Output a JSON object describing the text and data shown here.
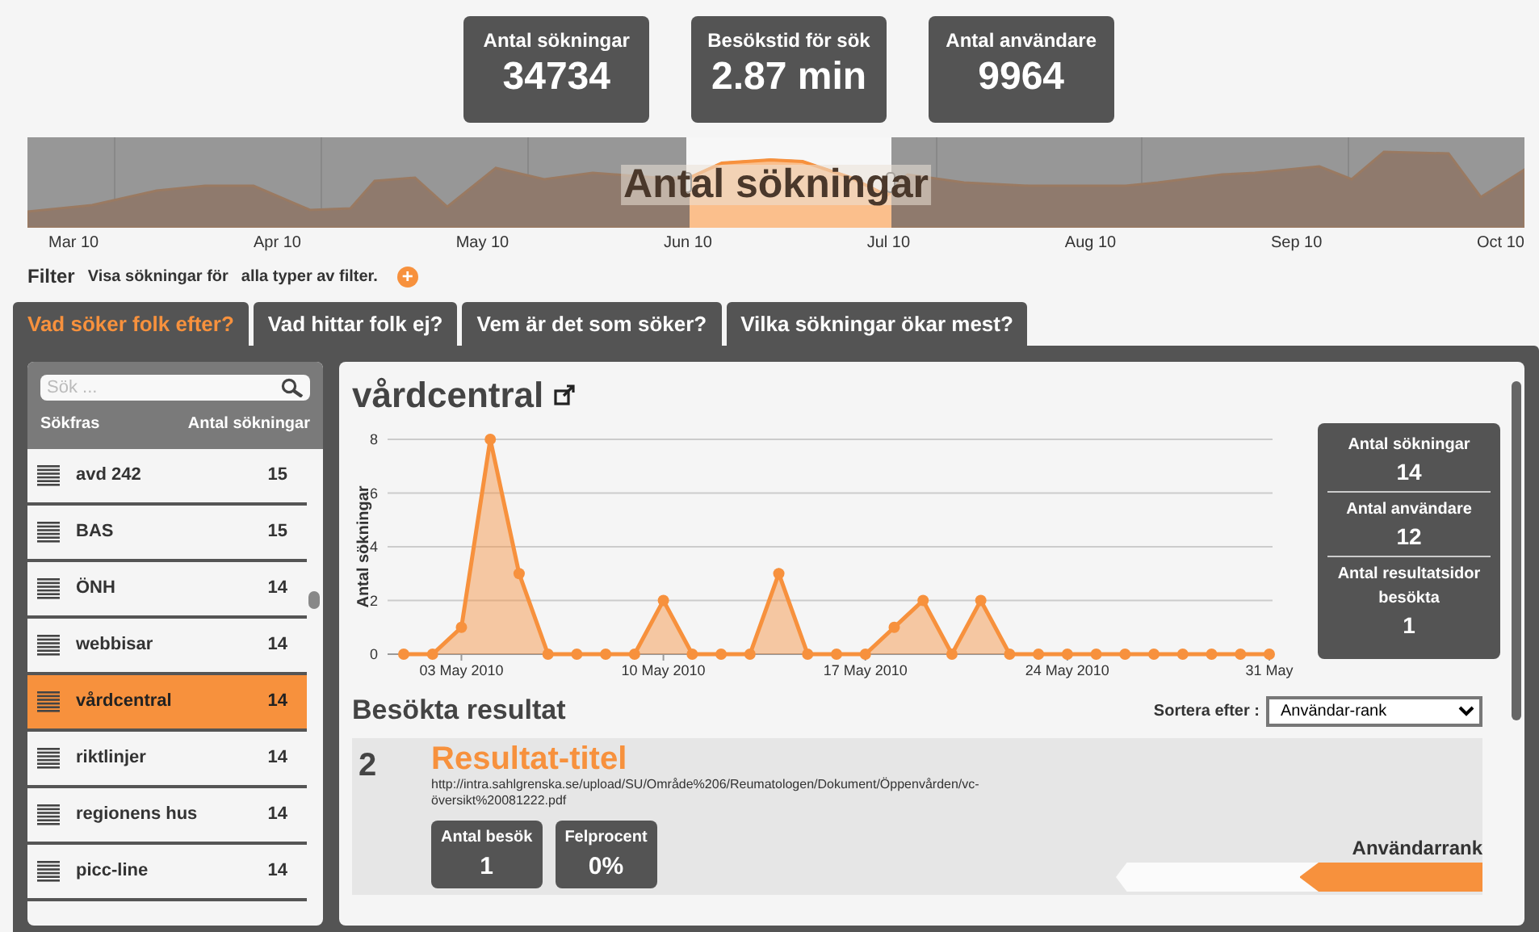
{
  "stats": [
    {
      "label": "Antal sökningar",
      "value": "34734"
    },
    {
      "label": "Besökstid för sök",
      "value": "2.87 min"
    },
    {
      "label": "Antal användare",
      "value": "9964"
    }
  ],
  "overview": {
    "overlay_title": "Antal sökningar",
    "month_labels": [
      "Mar 10",
      "Apr 10",
      "May 10",
      "Jun 10",
      "Jul 10",
      "Aug 10",
      "Sep 10",
      "Oct 10"
    ]
  },
  "filter": {
    "label": "Filter",
    "text": "Visa sökningar för",
    "value": "alla typer av filter.",
    "add_symbol": "+"
  },
  "tabs": [
    {
      "label": "Vad söker folk efter?",
      "selected": true
    },
    {
      "label": "Vad hittar folk ej?",
      "selected": false
    },
    {
      "label": "Vem är det som söker?",
      "selected": false
    },
    {
      "label": "Vilka sökningar ökar mest?",
      "selected": false
    }
  ],
  "sidebar": {
    "search_placeholder": "Sök ...",
    "columns": [
      "Sökfras",
      "Antal sökningar"
    ],
    "items": [
      {
        "phrase": "avd 242",
        "count": "15",
        "selected": false
      },
      {
        "phrase": "BAS",
        "count": "15",
        "selected": false
      },
      {
        "phrase": "ÖNH",
        "count": "14",
        "selected": false
      },
      {
        "phrase": "webbisar",
        "count": "14",
        "selected": false
      },
      {
        "phrase": "vårdcentral",
        "count": "14",
        "selected": true
      },
      {
        "phrase": "riktlinjer",
        "count": "14",
        "selected": false
      },
      {
        "phrase": "regionens hus",
        "count": "14",
        "selected": false
      },
      {
        "phrase": "picc-line",
        "count": "14",
        "selected": false
      }
    ]
  },
  "detail": {
    "title": "vårdcentral",
    "chart_data": {
      "type": "area",
      "ylabel": "Antal sökningar",
      "categories": [
        null,
        null,
        "03 May 2010",
        null,
        null,
        null,
        null,
        null,
        null,
        "10 May 2010",
        null,
        null,
        null,
        null,
        null,
        null,
        "17 May 2010",
        null,
        null,
        null,
        null,
        null,
        null,
        "24 May 2010",
        null,
        null,
        null,
        null,
        null,
        null,
        "31 May"
      ],
      "series": [
        {
          "color": "#f7913d",
          "values": [
            0,
            0,
            1,
            8,
            3,
            0,
            0,
            0,
            0,
            2,
            0,
            0,
            0,
            3,
            0,
            0,
            0,
            1,
            2,
            0,
            2,
            0,
            0,
            0,
            0,
            0,
            0,
            0,
            0,
            0,
            0
          ]
        }
      ],
      "ylim": [
        0,
        8
      ],
      "yticks": [
        0,
        2,
        4,
        6,
        8
      ],
      "grid": true
    },
    "side_stats": [
      {
        "label": "Antal sökningar",
        "value": "14"
      },
      {
        "label": "Antal användare",
        "value": "12"
      },
      {
        "label": "Antal resultatsidor besökta",
        "value": "1"
      }
    ],
    "results_heading": "Besökta resultat",
    "sort": {
      "label": "Sortera efter :",
      "value": "Användar-rank"
    },
    "results": [
      {
        "rank": "2",
        "title": "Resultat-titel",
        "url": "http://intra.sahlgrenska.se/upload/SU/Område%206/Reumatologen/Dokument/Öppenvården/vc-översikt%20081222.pdf",
        "metrics": [
          {
            "label": "Antal besök",
            "value": "1"
          },
          {
            "label": "Felprocent",
            "value": "0%"
          }
        ],
        "rank_label": "Användarrank",
        "level": 0.5
      }
    ]
  }
}
